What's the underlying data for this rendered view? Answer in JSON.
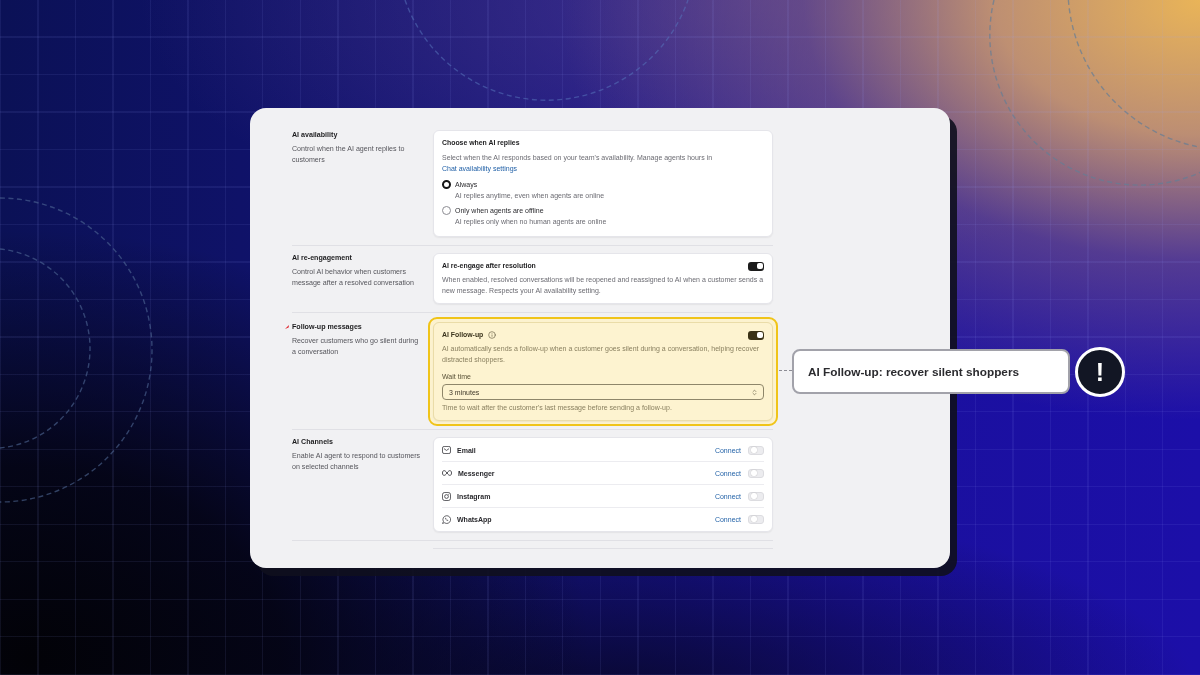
{
  "sections": [
    {
      "kind": "radio",
      "title": "AI availability",
      "description": "Control when the AI agent replies to customers",
      "highlighted": false,
      "marker": false,
      "card": {
        "title": "Choose when AI replies",
        "text": "Select when the AI responds based on your team's availability. Manage agents hours in",
        "link": "Chat availability settings",
        "options": [
          {
            "label": "Always",
            "hint": "AI replies anytime, even when agents are online",
            "selected": true
          },
          {
            "label": "Only when agents are offline",
            "hint": "AI replies only when no human agents are online",
            "selected": false
          }
        ]
      }
    },
    {
      "kind": "toggle",
      "title": "AI re-engagement",
      "description": "Control AI behavior when customers message after a resolved conversation",
      "highlighted": false,
      "marker": false,
      "card": {
        "title": "AI re-engage after resolution",
        "info": false,
        "on": true,
        "text": "When enabled, resolved conversations will be reopened and reassigned to AI when a customer sends a new message. Respects your AI availability setting."
      }
    },
    {
      "kind": "toggle",
      "title": "Follow-up messages",
      "description": "Recover customers who go silent during a conversation",
      "highlighted": true,
      "marker": true,
      "card": {
        "title": "AI Follow-up",
        "info": true,
        "on": true,
        "text": "AI automatically sends a follow-up when a customer goes silent during a conversation, helping recover distracted shoppers.",
        "field": {
          "label": "Wait time",
          "value": "3 minutes",
          "hint": "Time to wait after the customer's last message before sending a follow-up."
        }
      }
    },
    {
      "kind": "channels",
      "title": "AI Channels",
      "description": "Enable AI agent to respond to customers on selected channels",
      "highlighted": false,
      "marker": false,
      "card": {
        "channels": [
          {
            "name": "Email",
            "action": "Connect",
            "on": false
          },
          {
            "name": "Messenger",
            "action": "Connect",
            "on": false
          },
          {
            "name": "Instagram",
            "action": "Connect",
            "on": false
          },
          {
            "name": "WhatsApp",
            "action": "Connect",
            "on": false
          }
        ]
      }
    }
  ],
  "callout": {
    "text": "AI Follow-up: recover silent shoppers",
    "badge": "!"
  }
}
